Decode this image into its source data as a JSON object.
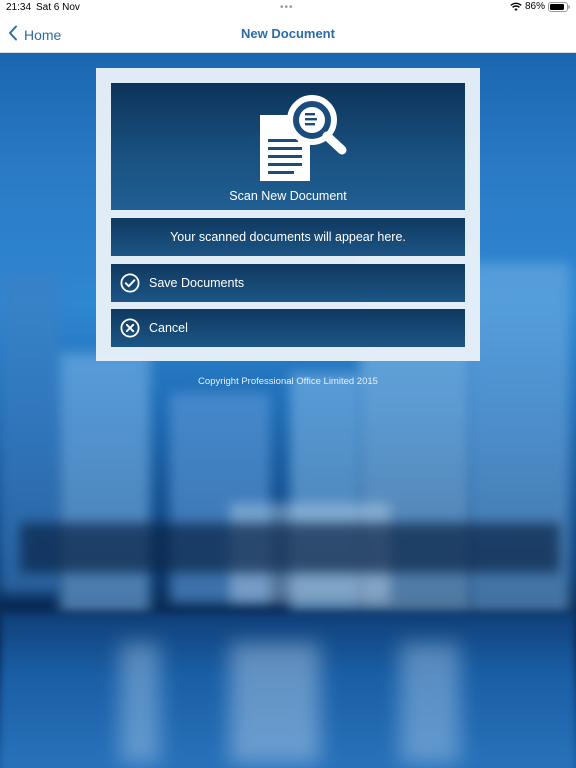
{
  "status_bar": {
    "time": "21:34",
    "date": "Sat 6 Nov",
    "battery": "86%"
  },
  "nav": {
    "back_label": "Home",
    "title": "New Document"
  },
  "card": {
    "scan_label": "Scan New Document",
    "info_text": "Your scanned documents will appear here.",
    "save_label": "Save Documents",
    "cancel_label": "Cancel"
  },
  "footer": {
    "copyright": "Copyright Professional Office Limited 2015"
  },
  "icons": {
    "scan": "document-search-icon",
    "save": "check-circle-icon",
    "cancel": "x-circle-icon",
    "back": "chevron-left-icon"
  },
  "colors": {
    "accent": "#2d6ca8",
    "button_dark": "#0f395f",
    "button_light": "#1c5585"
  }
}
